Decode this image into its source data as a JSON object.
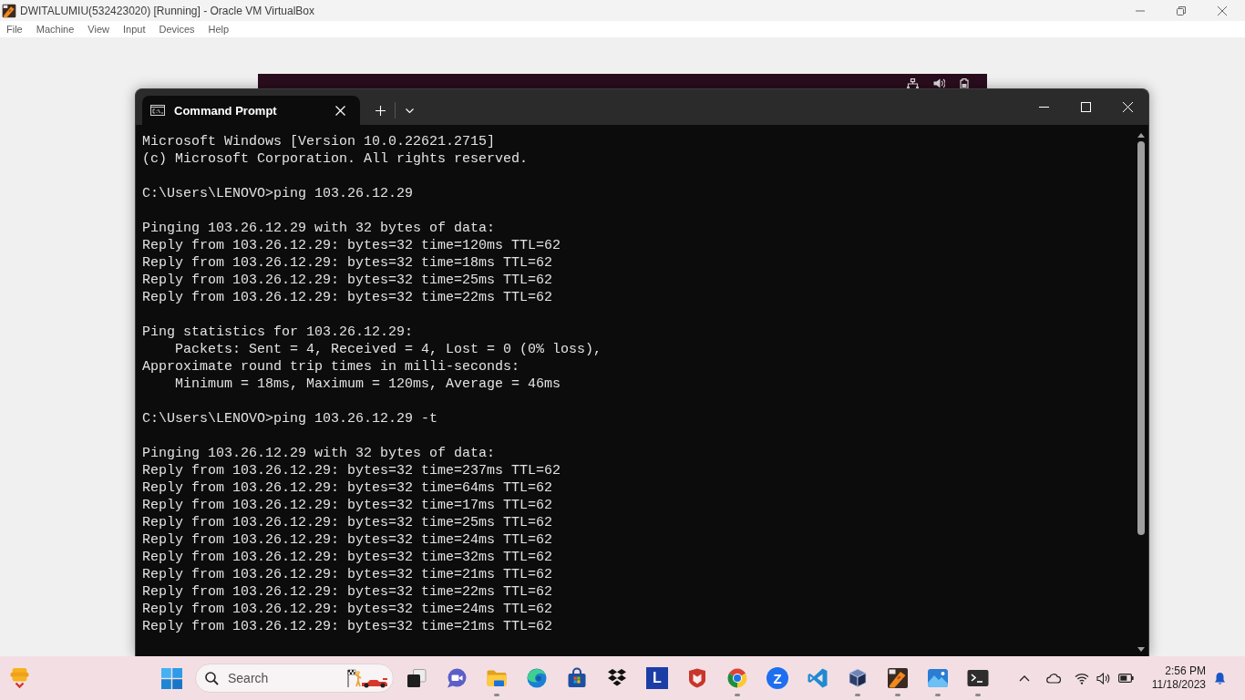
{
  "host_window": {
    "title": "DWITALUMIU(532423020) [Running] - Oracle VM VirtualBox"
  },
  "menu_bar": [
    "File",
    "Machine",
    "View",
    "Input",
    "Devices",
    "Help"
  ],
  "terminal": {
    "tabs": [
      {
        "label": "Command Prompt",
        "selected": true
      }
    ],
    "output": [
      [
        "Microsoft Windows [Version 10.0.22621.2715]",
        "(c) Microsoft Corporation. All rights reserved."
      ],
      [
        "C:\\Users\\LENOVO>ping 103.26.12.29"
      ],
      [
        "Pinging 103.26.12.29 with 32 bytes of data:",
        "Reply from 103.26.12.29: bytes=32 time=120ms TTL=62",
        "Reply from 103.26.12.29: bytes=32 time=18ms TTL=62",
        "Reply from 103.26.12.29: bytes=32 time=25ms TTL=62",
        "Reply from 103.26.12.29: bytes=32 time=22ms TTL=62"
      ],
      [
        "Ping statistics for 103.26.12.29:",
        "    Packets: Sent = 4, Received = 4, Lost = 0 (0% loss),",
        "Approximate round trip times in milli-seconds:",
        "    Minimum = 18ms, Maximum = 120ms, Average = 46ms"
      ],
      [
        "C:\\Users\\LENOVO>ping 103.26.12.29 -t"
      ],
      [
        "Pinging 103.26.12.29 with 32 bytes of data:",
        "Reply from 103.26.12.29: bytes=32 time=237ms TTL=62",
        "Reply from 103.26.12.29: bytes=32 time=64ms TTL=62",
        "Reply from 103.26.12.29: bytes=32 time=17ms TTL=62",
        "Reply from 103.26.12.29: bytes=32 time=25ms TTL=62",
        "Reply from 103.26.12.29: bytes=32 time=24ms TTL=62",
        "Reply from 103.26.12.29: bytes=32 time=32ms TTL=62",
        "Reply from 103.26.12.29: bytes=32 time=21ms TTL=62",
        "Reply from 103.26.12.29: bytes=32 time=22ms TTL=62",
        "Reply from 103.26.12.29: bytes=32 time=24ms TTL=62",
        "Reply from 103.26.12.29: bytes=32 time=21ms TTL=62"
      ]
    ]
  },
  "taskbar": {
    "search": {
      "placeholder": "Search"
    },
    "apps": [
      {
        "kind": "task-view",
        "running": false
      },
      {
        "kind": "chat",
        "running": false
      },
      {
        "kind": "folder",
        "running": true
      },
      {
        "kind": "swirl",
        "running": false
      },
      {
        "kind": "store",
        "running": false
      },
      {
        "kind": "diamonds",
        "running": false
      },
      {
        "kind": "letter-tile",
        "label": "L",
        "running": false
      },
      {
        "kind": "shield",
        "running": false
      },
      {
        "kind": "ring",
        "running": true
      },
      {
        "kind": "letter-circle",
        "label": "Z",
        "running": false
      },
      {
        "kind": "ribbon",
        "running": false
      },
      {
        "kind": "cube",
        "running": true
      },
      {
        "kind": "vm",
        "running": true
      },
      {
        "kind": "photos",
        "running": true
      },
      {
        "kind": "terminal",
        "running": true
      }
    ],
    "clock": {
      "time": "2:56 PM",
      "date": "11/18/2023"
    }
  }
}
